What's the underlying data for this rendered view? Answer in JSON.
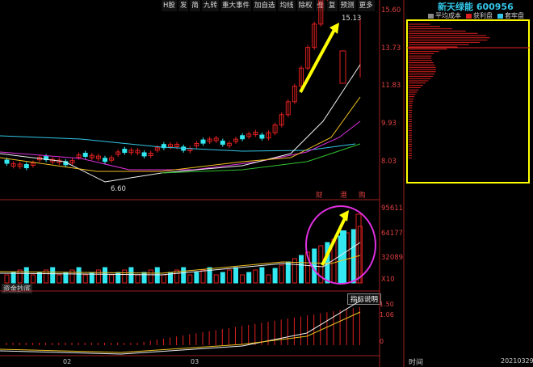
{
  "toolbar": {
    "items": [
      "H股",
      "发",
      "简",
      "九转",
      "重大事件",
      "加自选",
      "均线",
      "除权",
      "叠",
      "复",
      "预测",
      "更多"
    ]
  },
  "stock": {
    "name": "新天绿能",
    "code": "600956"
  },
  "legend": [
    {
      "label": "平均成本",
      "color": "#8a8a8a"
    },
    {
      "label": "获利盘",
      "color": "#e02020"
    },
    {
      "label": "套牢盘",
      "color": "#33c6e8"
    }
  ],
  "price_axis": [
    "15.60",
    "13.73",
    "11.83",
    "9.93",
    "8.03"
  ],
  "volume_axis": [
    "95611",
    "64177",
    "32089",
    "X10"
  ],
  "indicator_axis": [
    "1.50",
    "1.06",
    "0"
  ],
  "annotations": {
    "high": "15.13",
    "low": "6.60",
    "keywords": [
      "财",
      "港",
      "购"
    ],
    "capital_label": "资金抄底",
    "indicator_help": "指标说明",
    "time_label": "时间",
    "date_right": "20210329",
    "months": [
      "02",
      "03"
    ]
  },
  "colors": {
    "up": "#e02020",
    "down": "#33e8f0",
    "highlight": "#ffff00",
    "circle": "#e030e0"
  }
}
